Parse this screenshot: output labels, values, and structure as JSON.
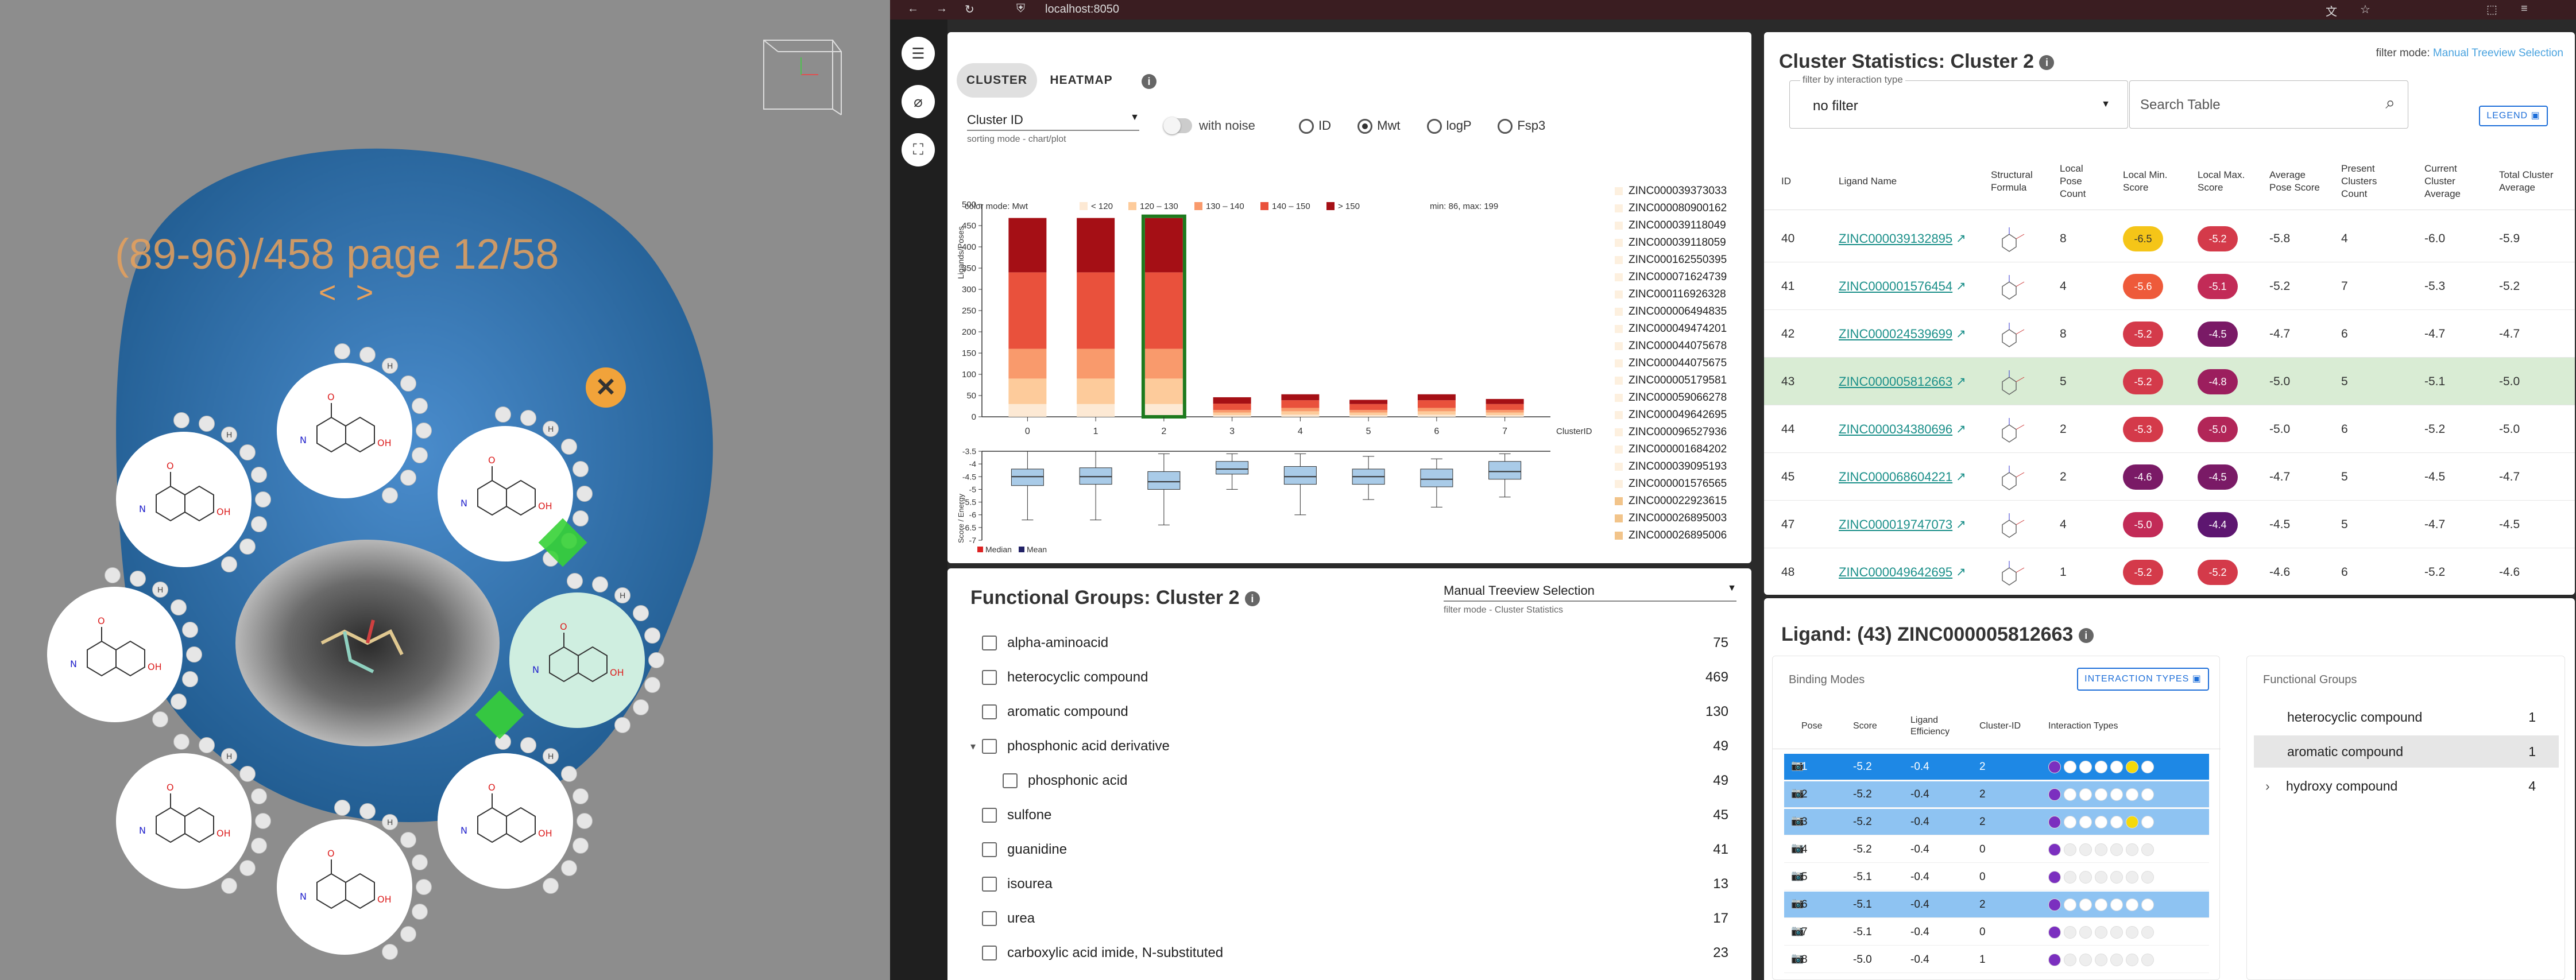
{
  "viewer": {
    "page_label": "(89-96)/458 page 12/58",
    "nav_arrows": "< >",
    "close_symbol": "×",
    "residue_label": "H"
  },
  "browser": {
    "url": "localhost:8050"
  },
  "cluster_panel": {
    "tabs": [
      "CLUSTER",
      "HEATMAP"
    ],
    "select_value": "Cluster ID",
    "select_caption": "sorting mode - chart/plot",
    "noise_label": "with noise",
    "radio_options": [
      "ID",
      "Mwt",
      "logP",
      "Fsp3"
    ],
    "radio_selected": "Mwt",
    "color_mode": "color mode: Mwt",
    "min_max": "min: 86, max: 199",
    "legend_bins": [
      {
        "label": "< 120",
        "color": "#fde9d4"
      },
      {
        "label": "120 – 130",
        "color": "#fdcb9b"
      },
      {
        "label": "130 – 140",
        "color": "#f99a6c"
      },
      {
        "label": "140 – 150",
        "color": "#e9513c"
      },
      {
        "label": "> 150",
        "color": "#a50f15"
      }
    ],
    "y_label_top": "Ligands/Poses",
    "y_label_bottom": "Score / Energy",
    "x_axis_title": "ClusterID",
    "bottom_legend": [
      "Median",
      "Mean"
    ],
    "zinc_list": [
      "ZINC000039373033",
      "ZINC000080900162",
      "ZINC000039118049",
      "ZINC000039118059",
      "ZINC000162550395",
      "ZINC000071624739",
      "ZINC000116926328",
      "ZINC000006494835",
      "ZINC000049474201",
      "ZINC000044075678",
      "ZINC000044075675",
      "ZINC000005179581",
      "ZINC000059066278",
      "ZINC000049642695",
      "ZINC000096527936",
      "ZINC000001684202",
      "ZINC000039095193",
      "ZINC000001576565",
      "ZINC000022923615",
      "ZINC000026895003",
      "ZINC000026895006"
    ]
  },
  "chart_data": [
    {
      "type": "bar",
      "categories": [
        "0",
        "1",
        "2",
        "3",
        "4",
        "5",
        "6",
        "7"
      ],
      "xlabel": "ClusterID",
      "ylabel": "Ligands/Poses",
      "ylim": [
        0,
        500
      ],
      "yticks": [
        0,
        50,
        100,
        150,
        200,
        250,
        300,
        350,
        400,
        450,
        500
      ],
      "stacked": true,
      "highlighted_category": "2",
      "series": [
        {
          "name": "< 120",
          "values": [
            30,
            30,
            30,
            4,
            5,
            4,
            5,
            4
          ]
        },
        {
          "name": "120 – 130",
          "values": [
            60,
            60,
            60,
            6,
            8,
            6,
            8,
            6
          ]
        },
        {
          "name": "130 – 140",
          "values": [
            70,
            70,
            70,
            6,
            8,
            6,
            8,
            6
          ]
        },
        {
          "name": "140 – 150",
          "values": [
            180,
            180,
            180,
            15,
            18,
            14,
            18,
            14
          ]
        },
        {
          "name": "> 150",
          "values": [
            128,
            128,
            128,
            15,
            14,
            10,
            14,
            12
          ]
        }
      ]
    },
    {
      "type": "box",
      "categories": [
        "0",
        "1",
        "2",
        "3",
        "4",
        "5",
        "6",
        "7"
      ],
      "ylabel": "Score / Energy",
      "ylim": [
        -7.0,
        -3.5
      ],
      "yticks": [
        -3.5,
        -4.0,
        -4.5,
        -5.0,
        -5.5,
        -6.0,
        -6.5,
        -7.0
      ],
      "boxes": [
        {
          "whislo": -6.2,
          "q1": -4.85,
          "med": -4.5,
          "q3": -4.2,
          "whishi": -3.5
        },
        {
          "whislo": -6.2,
          "q1": -4.8,
          "med": -4.5,
          "q3": -4.15,
          "whishi": -3.5
        },
        {
          "whislo": -6.4,
          "q1": -5.0,
          "med": -4.7,
          "q3": -4.3,
          "whishi": -3.6
        },
        {
          "whislo": -5.0,
          "q1": -4.4,
          "med": -4.2,
          "q3": -3.9,
          "whishi": -3.6
        },
        {
          "whislo": -6.0,
          "q1": -4.8,
          "med": -4.5,
          "q3": -4.1,
          "whishi": -3.6
        },
        {
          "whislo": -5.4,
          "q1": -4.8,
          "med": -4.5,
          "q3": -4.2,
          "whishi": -3.7
        },
        {
          "whislo": -5.7,
          "q1": -4.9,
          "med": -4.6,
          "q3": -4.2,
          "whishi": -3.8
        },
        {
          "whislo": -5.3,
          "q1": -4.6,
          "med": -4.3,
          "q3": -3.9,
          "whishi": -3.6
        }
      ]
    }
  ],
  "functional_groups": {
    "title": "Functional Groups: Cluster 2",
    "select_value": "Manual Treeview Selection",
    "select_caption": "filter mode - Cluster Statistics",
    "items": [
      {
        "label": "alpha-aminoacid",
        "count": "75",
        "indent": 0,
        "expander": ""
      },
      {
        "label": "heterocyclic compound",
        "count": "469",
        "indent": 0,
        "expander": ""
      },
      {
        "label": "aromatic compound",
        "count": "130",
        "indent": 0,
        "expander": ""
      },
      {
        "label": "phosphonic acid derivative",
        "count": "49",
        "indent": 0,
        "expander": "▾"
      },
      {
        "label": "phosphonic acid",
        "count": "49",
        "indent": 1,
        "expander": ""
      },
      {
        "label": "sulfone",
        "count": "45",
        "indent": 0,
        "expander": ""
      },
      {
        "label": "guanidine",
        "count": "41",
        "indent": 0,
        "expander": ""
      },
      {
        "label": "isourea",
        "count": "13",
        "indent": 0,
        "expander": ""
      },
      {
        "label": "urea",
        "count": "17",
        "indent": 0,
        "expander": ""
      },
      {
        "label": "carboxylic acid imide, N-substituted",
        "count": "23",
        "indent": 0,
        "expander": ""
      }
    ]
  },
  "cluster_stats": {
    "title": "Cluster Statistics: Cluster 2",
    "filter_mode_label": "filter mode:",
    "filter_mode_value": "Manual Treeview Selection",
    "filter_caption": "filter by interaction type",
    "filter_value": "no filter",
    "search_placeholder": "Search Table",
    "legend_button": "LEGEND",
    "columns": [
      "ID",
      "Ligand Name",
      "Structural Formula",
      "Local Pose Count",
      "Local Min. Score",
      "Local Max. Score",
      "Average Pose Score",
      "Present Clusters Count",
      "Current Cluster Average",
      "Total Cluster Average"
    ],
    "rows": [
      {
        "id": "40",
        "name": "ZINC000039132895",
        "pose": "8",
        "min": "-6.5",
        "min_color": "#f5c518",
        "max": "-5.2",
        "max_color": "#d43a4a",
        "avg": "-5.8",
        "present": "4",
        "cur": "-6.0",
        "tot": "-5.9",
        "selected": false
      },
      {
        "id": "41",
        "name": "ZINC000001576454",
        "pose": "4",
        "min": "-5.6",
        "min_color": "#ee5a3a",
        "max": "-5.1",
        "max_color": "#c22b57",
        "avg": "-5.2",
        "present": "7",
        "cur": "-5.3",
        "tot": "-5.2",
        "selected": false
      },
      {
        "id": "42",
        "name": "ZINC000024539699",
        "pose": "8",
        "min": "-5.2",
        "min_color": "#d43a4a",
        "max": "-4.5",
        "max_color": "#7a1a66",
        "avg": "-4.7",
        "present": "6",
        "cur": "-4.7",
        "tot": "-4.7",
        "selected": false
      },
      {
        "id": "43",
        "name": "ZINC000005812663",
        "pose": "5",
        "min": "-5.2",
        "min_color": "#d43a4a",
        "max": "-4.8",
        "max_color": "#9c1e5e",
        "avg": "-5.0",
        "present": "5",
        "cur": "-5.1",
        "tot": "-5.0",
        "selected": true
      },
      {
        "id": "44",
        "name": "ZINC000034380696",
        "pose": "2",
        "min": "-5.3",
        "min_color": "#d43a4a",
        "max": "-5.0",
        "max_color": "#b22658",
        "avg": "-5.0",
        "present": "6",
        "cur": "-5.2",
        "tot": "-5.0",
        "selected": false
      },
      {
        "id": "45",
        "name": "ZINC000068604221",
        "pose": "2",
        "min": "-4.6",
        "min_color": "#7a1a66",
        "max": "-4.5",
        "max_color": "#7a1a66",
        "avg": "-4.7",
        "present": "5",
        "cur": "-4.5",
        "tot": "-4.7",
        "selected": false
      },
      {
        "id": "47",
        "name": "ZINC000019747073",
        "pose": "4",
        "min": "-5.0",
        "min_color": "#c22b57",
        "max": "-4.4",
        "max_color": "#5d1670",
        "avg": "-4.5",
        "present": "5",
        "cur": "-4.7",
        "tot": "-4.5",
        "selected": false
      },
      {
        "id": "48",
        "name": "ZINC000049642695",
        "pose": "1",
        "min": "-5.2",
        "min_color": "#d43a4a",
        "max": "-5.2",
        "max_color": "#d43a4a",
        "avg": "-4.6",
        "present": "6",
        "cur": "-5.2",
        "tot": "-4.6",
        "selected": false
      }
    ]
  },
  "ligand": {
    "title": "Ligand: (43) ZINC000005812663",
    "binding_modes_label": "Binding Modes",
    "interaction_types_button": "INTERACTION TYPES",
    "columns": [
      "Pose",
      "Score",
      "Ligand Efficiency",
      "Cluster-ID",
      "Interaction Types"
    ],
    "rows": [
      {
        "pose": "1",
        "score": "-5.2",
        "eff": "-0.4",
        "cluster": "2",
        "style": "dark",
        "dots": [
          "#7b2fbf",
          "#fff",
          "#fff",
          "#fff",
          "#fff",
          "#f5d90a",
          "#fff"
        ]
      },
      {
        "pose": "2",
        "score": "-5.2",
        "eff": "-0.4",
        "cluster": "2",
        "style": "light",
        "dots": [
          "#7b2fbf",
          "#fff",
          "#fff",
          "#fff",
          "#fff",
          "#fff",
          "#fff"
        ]
      },
      {
        "pose": "3",
        "score": "-5.2",
        "eff": "-0.4",
        "cluster": "2",
        "style": "light",
        "dots": [
          "#7b2fbf",
          "#fff",
          "#fff",
          "#fff",
          "#fff",
          "#f5d90a",
          "#fff"
        ]
      },
      {
        "pose": "4",
        "score": "-5.2",
        "eff": "-0.4",
        "cluster": "0",
        "style": "none",
        "dots": [
          "#7b2fbf",
          "#eee",
          "#eee",
          "#eee",
          "#eee",
          "#eee",
          "#eee"
        ]
      },
      {
        "pose": "5",
        "score": "-5.1",
        "eff": "-0.4",
        "cluster": "0",
        "style": "none",
        "dots": [
          "#7b2fbf",
          "#eee",
          "#eee",
          "#eee",
          "#eee",
          "#eee",
          "#eee"
        ]
      },
      {
        "pose": "6",
        "score": "-5.1",
        "eff": "-0.4",
        "cluster": "2",
        "style": "light",
        "dots": [
          "#7b2fbf",
          "#fff",
          "#fff",
          "#fff",
          "#fff",
          "#fff",
          "#fff"
        ]
      },
      {
        "pose": "7",
        "score": "-5.1",
        "eff": "-0.4",
        "cluster": "0",
        "style": "none",
        "dots": [
          "#7b2fbf",
          "#eee",
          "#eee",
          "#eee",
          "#eee",
          "#eee",
          "#eee"
        ]
      },
      {
        "pose": "8",
        "score": "-5.0",
        "eff": "-0.4",
        "cluster": "1",
        "style": "none",
        "dots": [
          "#7b2fbf",
          "#eee",
          "#eee",
          "#eee",
          "#eee",
          "#eee",
          "#eee"
        ]
      }
    ],
    "functional_groups_label": "Functional Groups",
    "functional_groups": [
      {
        "label": "heterocyclic compound",
        "count": "1",
        "selected": false,
        "expander": ""
      },
      {
        "label": "aromatic compound",
        "count": "1",
        "selected": true,
        "expander": ""
      },
      {
        "label": "hydroxy compound",
        "count": "4",
        "selected": false,
        "expander": "›"
      }
    ]
  },
  "colors": {
    "accent": "#1e88e5",
    "selected_row": "#d9ecd4",
    "pose_dark": "#1e88e5",
    "pose_light": "#8ec3f2",
    "protein": "#2e6ca3",
    "page_label": "#e8a15c"
  }
}
